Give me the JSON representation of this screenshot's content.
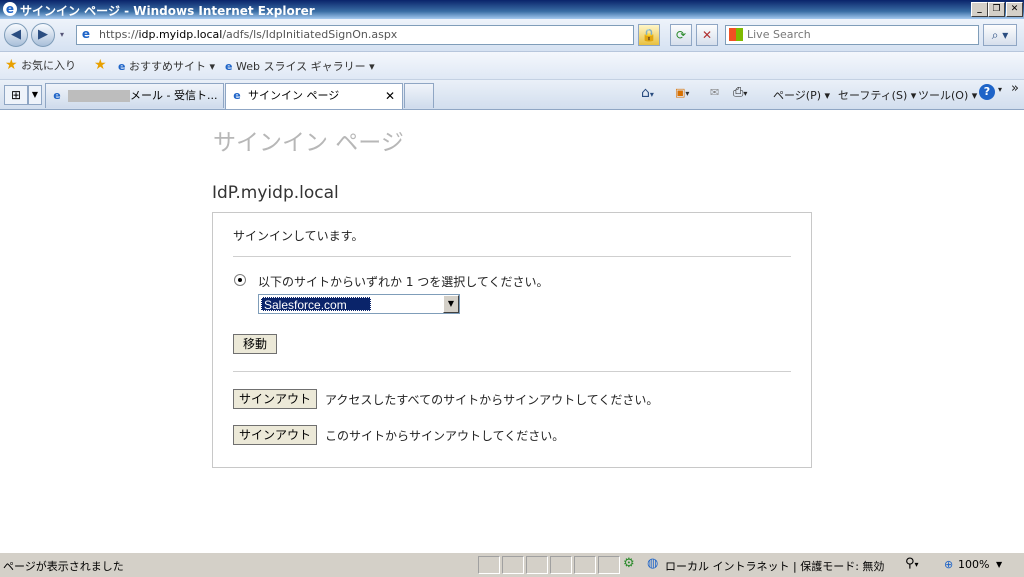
{
  "window": {
    "title": "サインイン ページ - Windows Internet Explorer",
    "buttons": {
      "minimize": "_",
      "maximize": "❐",
      "close": "✕"
    }
  },
  "address_bar": {
    "url_prefix": "https://",
    "url_host": "idp.myidp.local",
    "url_path": "/adfs/ls/IdpInitiatedSignOn.aspx",
    "search_placeholder": "Live Search"
  },
  "favorites_bar": {
    "favorites_label": "お気に入り",
    "suggested_sites": "おすすめサイト ▾",
    "web_slice_gallery": "Web スライス ギャラリー ▾"
  },
  "tabs": [
    {
      "label": "メール - 受信ト..."
    },
    {
      "label": "サインイン ページ"
    }
  ],
  "command_bar": {
    "page": "ページ(P) ▾",
    "safety": "セーフティ(S) ▾",
    "tools": "ツール(O) ▾",
    "more": "»"
  },
  "page": {
    "title": "サインイン ページ",
    "idp_name": "IdP.myidp.local",
    "signing_in_text": "サインインしています。",
    "radio_label": "以下のサイトからいずれか 1 つを選択してください。",
    "site_select_value": "Salesforce.com",
    "go_button": "移動",
    "signout_all_button": "サインアウト",
    "signout_all_text": "アクセスしたすべてのサイトからサインアウトしてください。",
    "signout_this_button": "サインアウト",
    "signout_this_text": "このサイトからサインアウトしてください。"
  },
  "status_bar": {
    "status_text": "ページが表示されました",
    "zone_text": "ローカル イントラネット | 保護モード: 無効",
    "zoom": "100%"
  },
  "icons": [
    "ie-logo-icon",
    "back-icon",
    "forward-icon",
    "lock-icon",
    "refresh-icon",
    "stop-icon",
    "search-icon",
    "star-icon",
    "home-icon",
    "feeds-icon",
    "mail-icon",
    "print-icon",
    "help-icon"
  ]
}
